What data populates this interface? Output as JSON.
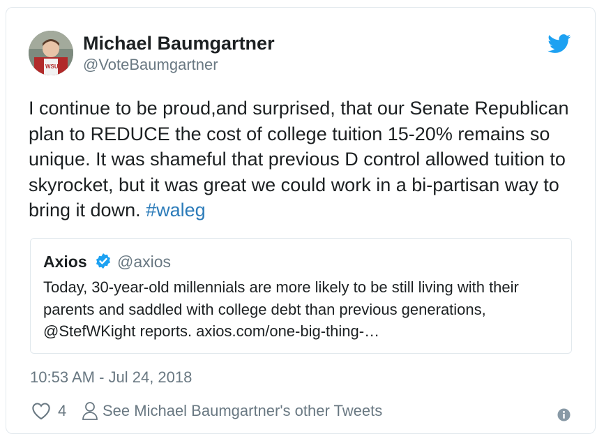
{
  "tweet": {
    "author_name": "Michael Baumgartner",
    "author_handle": "@VoteBaumgartner",
    "text": "I continue to be proud,and surprised, that our Senate Republican plan to REDUCE the cost of college tuition 15-20% remains so unique. It was shameful that previous D control allowed tuition to skyrocket, but it was great we could work in a bi-partisan way to bring it down.",
    "hashtag": "#waleg",
    "timestamp": "10:53 AM - Jul 24, 2018",
    "like_count": "4",
    "see_other_tweets": "See Michael Baumgartner's other Tweets"
  },
  "quoted_tweet": {
    "author_name": "Axios",
    "author_handle": "@axios",
    "text": "Today, 30-year-old millennials are more likely to be still living with their parents and saddled with college debt than previous generations, @StefWKight reports. axios.com/one-big-thing-…"
  },
  "colors": {
    "text": "#1c2022",
    "muted": "#697882",
    "link": "#2b7bb9",
    "twitter_blue": "#1da1f2",
    "border": "#e1e8ed"
  },
  "icons": [
    "twitter-bird-icon",
    "verified-badge-icon",
    "heart-icon",
    "person-icon",
    "info-icon"
  ]
}
